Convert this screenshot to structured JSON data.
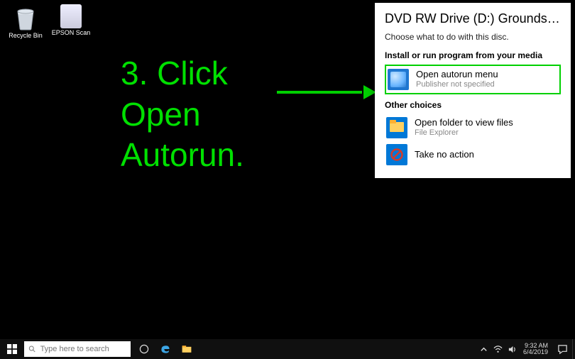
{
  "desktop": {
    "icons": [
      {
        "label": "Recycle Bin"
      },
      {
        "label": "EPSON Scan"
      }
    ]
  },
  "instruction": {
    "text": "3. Click\nOpen\nAutorun."
  },
  "autoplay": {
    "title": "DVD RW Drive (D:) Grounds…",
    "subtitle": "Choose what to do with this disc.",
    "section1": "Install or run program from your media",
    "autorun": {
      "title": "Open autorun menu",
      "sub": "Publisher not specified"
    },
    "section2": "Other choices",
    "folder": {
      "title": "Open folder to view files",
      "sub": "File Explorer"
    },
    "noaction": {
      "title": "Take no action"
    }
  },
  "taskbar": {
    "search_placeholder": "Type here to search",
    "time": "9:32 AM",
    "date": "6/4/2019"
  }
}
